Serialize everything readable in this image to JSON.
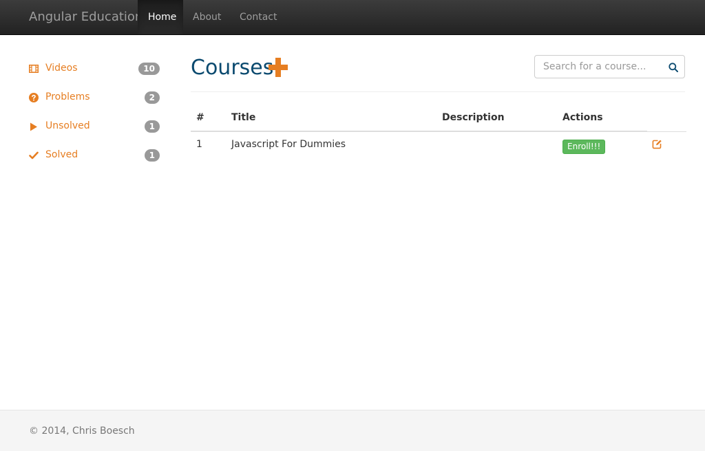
{
  "navbar": {
    "brand": "Angular Education",
    "items": [
      {
        "label": "Home",
        "active": true
      },
      {
        "label": "About",
        "active": false
      },
      {
        "label": "Contact",
        "active": false
      }
    ]
  },
  "sidebar": {
    "items": [
      {
        "label": "Videos",
        "count": "10",
        "icon": "film-icon"
      },
      {
        "label": "Problems",
        "count": "2",
        "icon": "question-circle-icon"
      },
      {
        "label": "Unsolved",
        "count": "1",
        "icon": "play-icon"
      },
      {
        "label": "Solved",
        "count": "1",
        "icon": "checkmark-icon"
      }
    ]
  },
  "main": {
    "title": "Courses",
    "add_icon": "plus-icon",
    "search": {
      "placeholder": "Search for a course...",
      "icon": "search-icon"
    },
    "table": {
      "headers": [
        "#",
        "Title",
        "Description",
        "Actions"
      ],
      "rows": [
        {
          "num": "1",
          "title": "Javascript For Dummies",
          "description": "",
          "action_label": "Enroll!!!",
          "edit_icon": "edit-icon"
        }
      ]
    }
  },
  "footer": {
    "text": "© 2014, Chris Boesch"
  },
  "colors": {
    "accent": "#e67e22",
    "title": "#0b4a6f",
    "badge": "#999999",
    "enroll": "#5cb85c",
    "navbar": "#222222"
  }
}
